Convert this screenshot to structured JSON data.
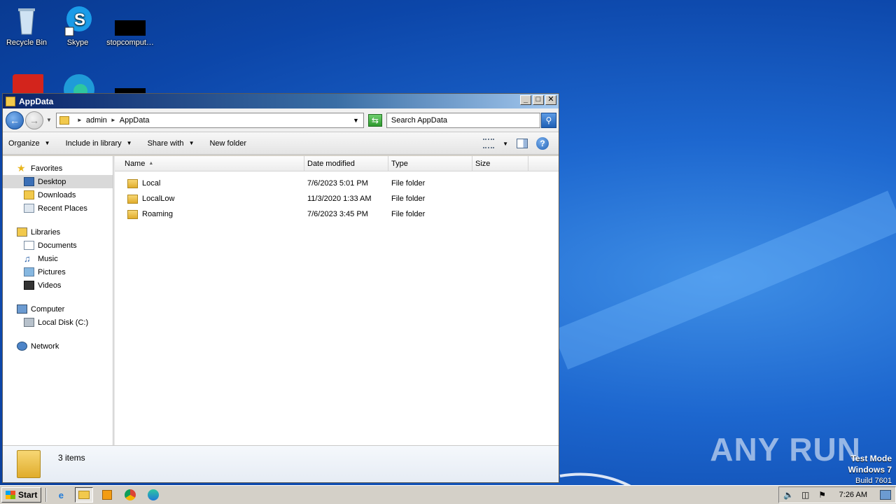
{
  "desktop": {
    "icons": [
      {
        "label": "Recycle Bin",
        "icon": "recycle-bin-icon"
      },
      {
        "label": "Skype",
        "icon": "skype-icon"
      },
      {
        "label": "stopcomput…",
        "icon": "black-file-icon"
      },
      {
        "label": "",
        "icon": "acrobat-icon"
      },
      {
        "label": "",
        "icon": "edge-icon"
      },
      {
        "label": "",
        "icon": "black-file-icon"
      }
    ]
  },
  "window": {
    "title": "AppData",
    "buttons": {
      "minimize": "_",
      "maximize": "□",
      "close": "✕"
    }
  },
  "address": {
    "crumbs": [
      "admin",
      "AppData"
    ],
    "search_placeholder": "Search AppData"
  },
  "toolbar": {
    "organize": "Organize",
    "include": "Include in library",
    "share": "Share with",
    "new_folder": "New folder"
  },
  "nav": {
    "favorites": "Favorites",
    "desktop": "Desktop",
    "downloads": "Downloads",
    "recent": "Recent Places",
    "libraries": "Libraries",
    "documents": "Documents",
    "music": "Music",
    "pictures": "Pictures",
    "videos": "Videos",
    "computer": "Computer",
    "localdisk": "Local Disk (C:)",
    "network": "Network"
  },
  "columns": [
    "Name",
    "Date modified",
    "Type",
    "Size"
  ],
  "files": [
    {
      "name": "Local",
      "date": "7/6/2023 5:01 PM",
      "type": "File folder",
      "size": ""
    },
    {
      "name": "LocalLow",
      "date": "11/3/2020 1:33 AM",
      "type": "File folder",
      "size": ""
    },
    {
      "name": "Roaming",
      "date": "7/6/2023 3:45 PM",
      "type": "File folder",
      "size": ""
    }
  ],
  "details": {
    "count": "3 items"
  },
  "watermark": "ANY RUN",
  "testmode": {
    "line1": "Test Mode",
    "line2": "Windows 7",
    "line3": "Build 7601"
  },
  "taskbar": {
    "start": "Start",
    "apps": [
      "internet-explorer-icon",
      "explorer-icon",
      "media-player-icon",
      "chrome-icon",
      "edge-icon"
    ],
    "clock": "7:26 AM"
  }
}
